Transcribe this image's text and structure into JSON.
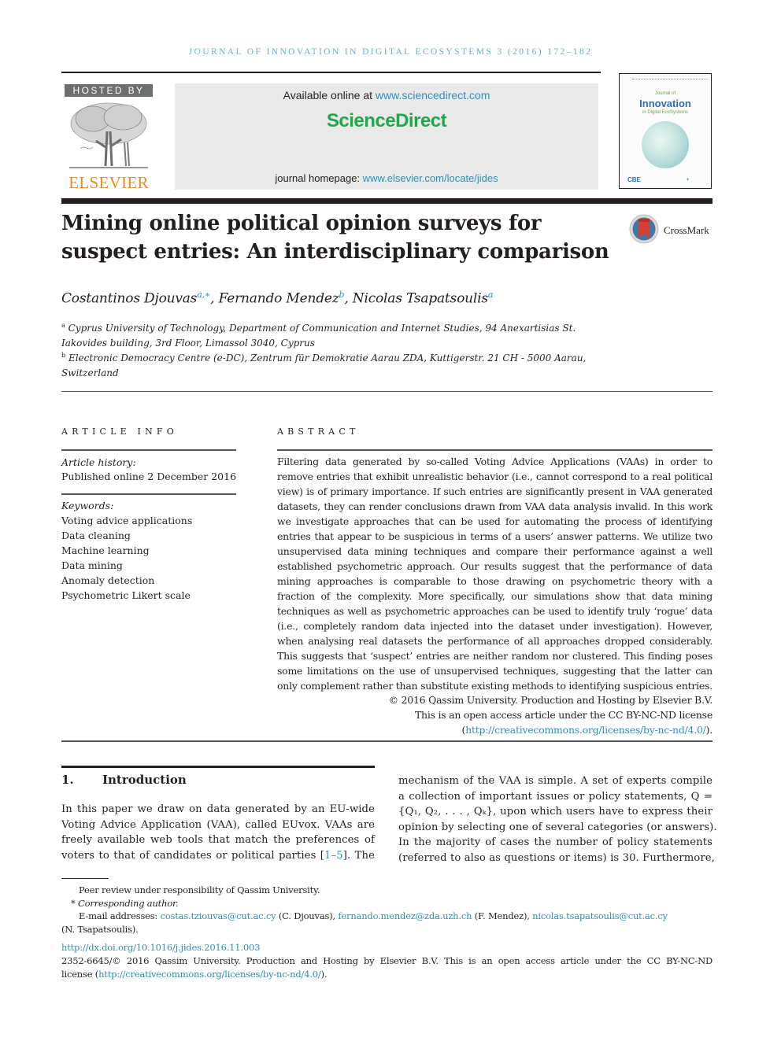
{
  "running_head": "Journal of Innovation in Digital Ecosystems 3 (2016) 172–182",
  "header": {
    "hosted_by": "HOSTED BY",
    "publisher_logo_text": "ELSEVIER",
    "available_prefix": "Available online at ",
    "available_link": "www.sciencedirect.com",
    "sciencedirect_logo": "ScienceDirect",
    "homepage_prefix": "journal homepage: ",
    "homepage_link": "www.elsevier.com/locate/jides",
    "cover": {
      "line1": "Journal of",
      "line2": "Innovation",
      "line3": "in Digital EcoSystems",
      "badge": "CBE"
    }
  },
  "article": {
    "title": "Mining online political opinion surveys for suspect entries: An interdisciplinary comparison",
    "crossmark_label": "CrossMark",
    "authors": [
      {
        "name": "Costantinos Djouvas",
        "sup": "a,∗"
      },
      {
        "name": "Fernando Mendez",
        "sup": "b"
      },
      {
        "name": "Nicolas Tsapatsoulis",
        "sup": "a"
      }
    ],
    "affiliations": [
      {
        "mark": "a",
        "line1": "Cyprus University of Technology, Department of Communication and Internet Studies, 94 Anexartisias St.",
        "line2": "Iakovides building, 3rd Floor, Limassol 3040, Cyprus"
      },
      {
        "mark": "b",
        "line1": "Electronic Democracy Centre (e-DC), Zentrum für Demokratie Aarau ZDA, Kuttigerstr. 21 CH - 5000 Aarau,",
        "line2": "Switzerland"
      }
    ]
  },
  "article_info": {
    "heading": "ARTICLE INFO",
    "history_label": "Article history:",
    "history_value": "Published online 2 December 2016",
    "keywords_label": "Keywords:",
    "keywords": [
      "Voting advice applications",
      "Data cleaning",
      "Machine learning",
      "Data mining",
      "Anomaly detection",
      "Psychometric Likert scale"
    ]
  },
  "abstract": {
    "heading": "ABSTRACT",
    "body": "Filtering data generated by so-called Voting Advice Applications (VAAs) in order to remove entries that exhibit unrealistic behavior (i.e., cannot correspond to a real political view) is of primary importance. If such entries are significantly present in VAA generated datasets, they can render conclusions drawn from VAA data analysis invalid. In this work we investigate approaches that can be used for automating the process of identifying entries that appear to be suspicious in terms of a users’ answer patterns. We utilize two unsupervised data mining techniques and compare their performance against a well established psychometric approach. Our results suggest that the performance of data mining approaches is comparable to those drawing on psychometric theory with a fraction of the complexity. More specifically, our simulations show that data mining techniques as well as psychometric approaches can be used to identify truly ‘rogue’ data (i.e., completely random data injected into the dataset under investigation). However, when analysing real datasets the performance of all approaches dropped considerably. This suggests that ‘suspect’ entries are neither random nor clustered. This finding poses some limitations on the use of unsupervised techniques, suggesting that the latter can only complement rather than substitute existing methods to identifying suspicious entries.",
    "copyright_line": "© 2016 Qassim University. Production and Hosting by Elsevier B.V.",
    "license_line": "This is an open access article under the CC BY-NC-ND license",
    "license_link": "http://creativecommons.org/licenses/by-nc-nd/4.0/",
    "license_open": "(",
    "license_close": ")."
  },
  "introduction": {
    "number": "1.",
    "heading": "Introduction",
    "left_lines": [
      "In this paper we draw on data generated by an EU-wide",
      "Voting Advice Application (VAA), called EUvox. VAAs are",
      "freely available web tools that match the preferences of"
    ],
    "left_last_prefix": "voters to that of candidates or political parties [",
    "left_last_ref": "1–5",
    "left_last_suffix": "]. The",
    "right_lines": [
      "mechanism of the VAA is simple. A set of experts compile",
      "a collection of important issues or policy statements, Q =",
      "{Q₁, Q₂, . . . , Qₖ}, upon which users have to express their",
      "opinion by selecting one of several categories (or answers).",
      "In the majority of cases the number of policy statements",
      "(referred to also as questions or items) is 30. Furthermore,"
    ]
  },
  "footnotes": {
    "peer_review": "Peer review under responsibility of Qassim University.",
    "corresponding_mark": "*",
    "corresponding": "Corresponding author.",
    "email_label": "E-mail addresses: ",
    "emails": [
      {
        "address": "costas.tziouvas@cut.ac.cy",
        "who": " (C. Djouvas), "
      },
      {
        "address": "fernando.mendez@zda.uzh.ch",
        "who": " (F. Mendez), "
      },
      {
        "address": "nicolas.tsapatsoulis@cut.ac.cy",
        "who": ""
      }
    ],
    "email_tail": "(N. Tsapatsoulis).",
    "doi": "http://dx.doi.org/10.1016/j.jides.2016.11.003",
    "issn_line": "2352-6645/© 2016 Qassim University.  Production and Hosting by Elsevier B.V. This is an open access article under the CC BY-NC-ND",
    "license_prefix": "license (",
    "license_link": "http://creativecommons.org/licenses/by-nc-nd/4.0/",
    "license_suffix": ")."
  }
}
